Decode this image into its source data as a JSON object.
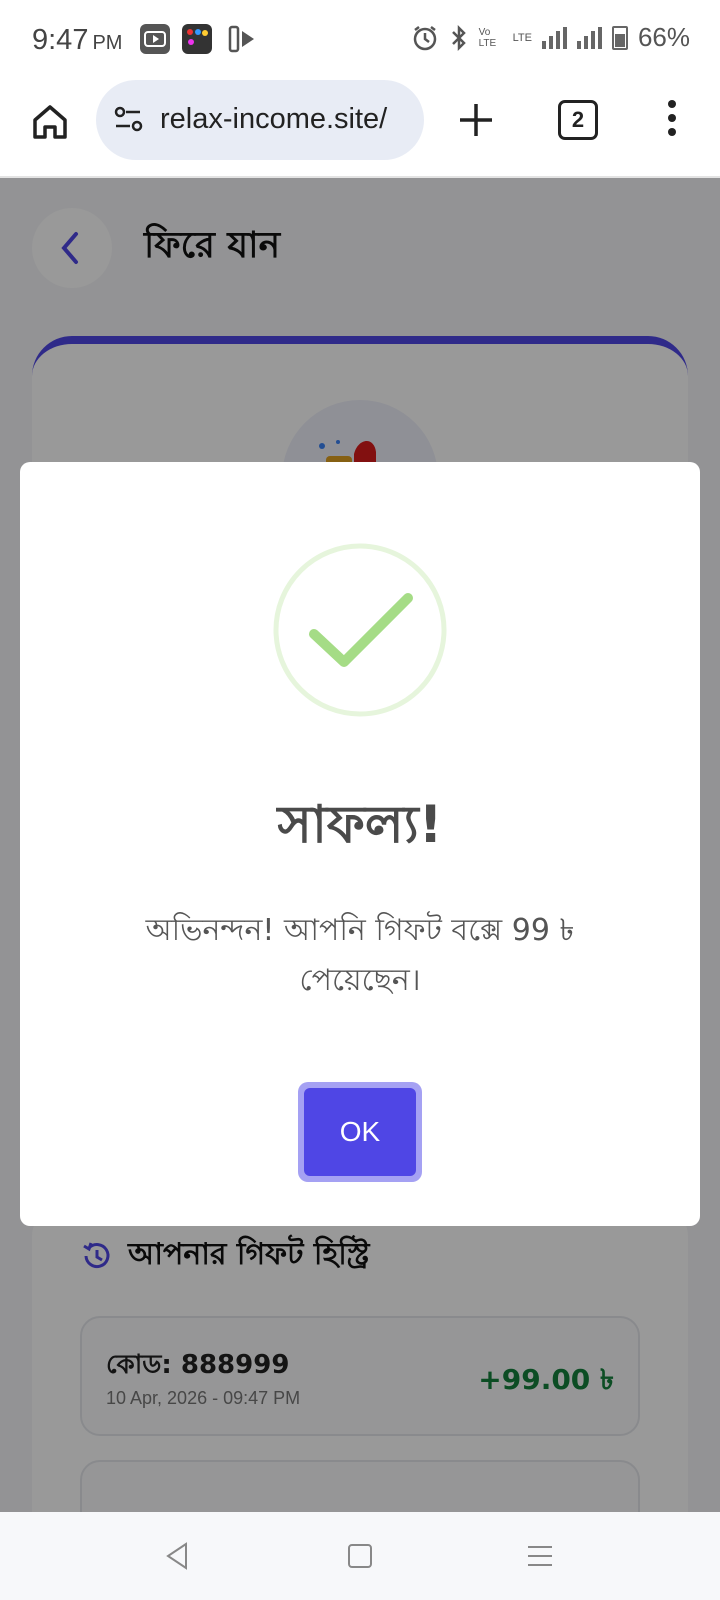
{
  "status_bar": {
    "time": "9:47",
    "ampm": "PM",
    "network_volte": "Vo LTE",
    "network_lte": "LTE",
    "battery": "66%",
    "icons": [
      "youtube-icon",
      "app-icon",
      "play-store-icon",
      "alarm-icon",
      "bluetooth-icon",
      "signal-icon",
      "battery-icon"
    ]
  },
  "browser": {
    "url": "relax-income.site/",
    "tab_count": "2",
    "icons": [
      "home-icon",
      "site-settings-icon",
      "new-tab-plus-icon",
      "tab-switcher-icon",
      "overflow-menu-icon"
    ]
  },
  "page": {
    "back_label": "ফিরে যান",
    "history": {
      "title": "আপনার গিফট হিস্ট্রি",
      "items": [
        {
          "code": "কোড: 888999",
          "date": "10 Apr, 2026 - 09:47 PM",
          "amount": "+99.00 ৳"
        }
      ]
    }
  },
  "modal": {
    "title": "সাফল্য!",
    "message": "অভিনন্দন! আপনি গিফট বক্সে 99 ৳ পেয়েছেন।",
    "ok_label": "OK"
  },
  "colors": {
    "accent": "#4f46e5",
    "success": "#15803d",
    "check_green": "#a5dc86",
    "ring_green": "#e6f5dc",
    "overlay": "rgba(0,0,0,0.40)"
  }
}
